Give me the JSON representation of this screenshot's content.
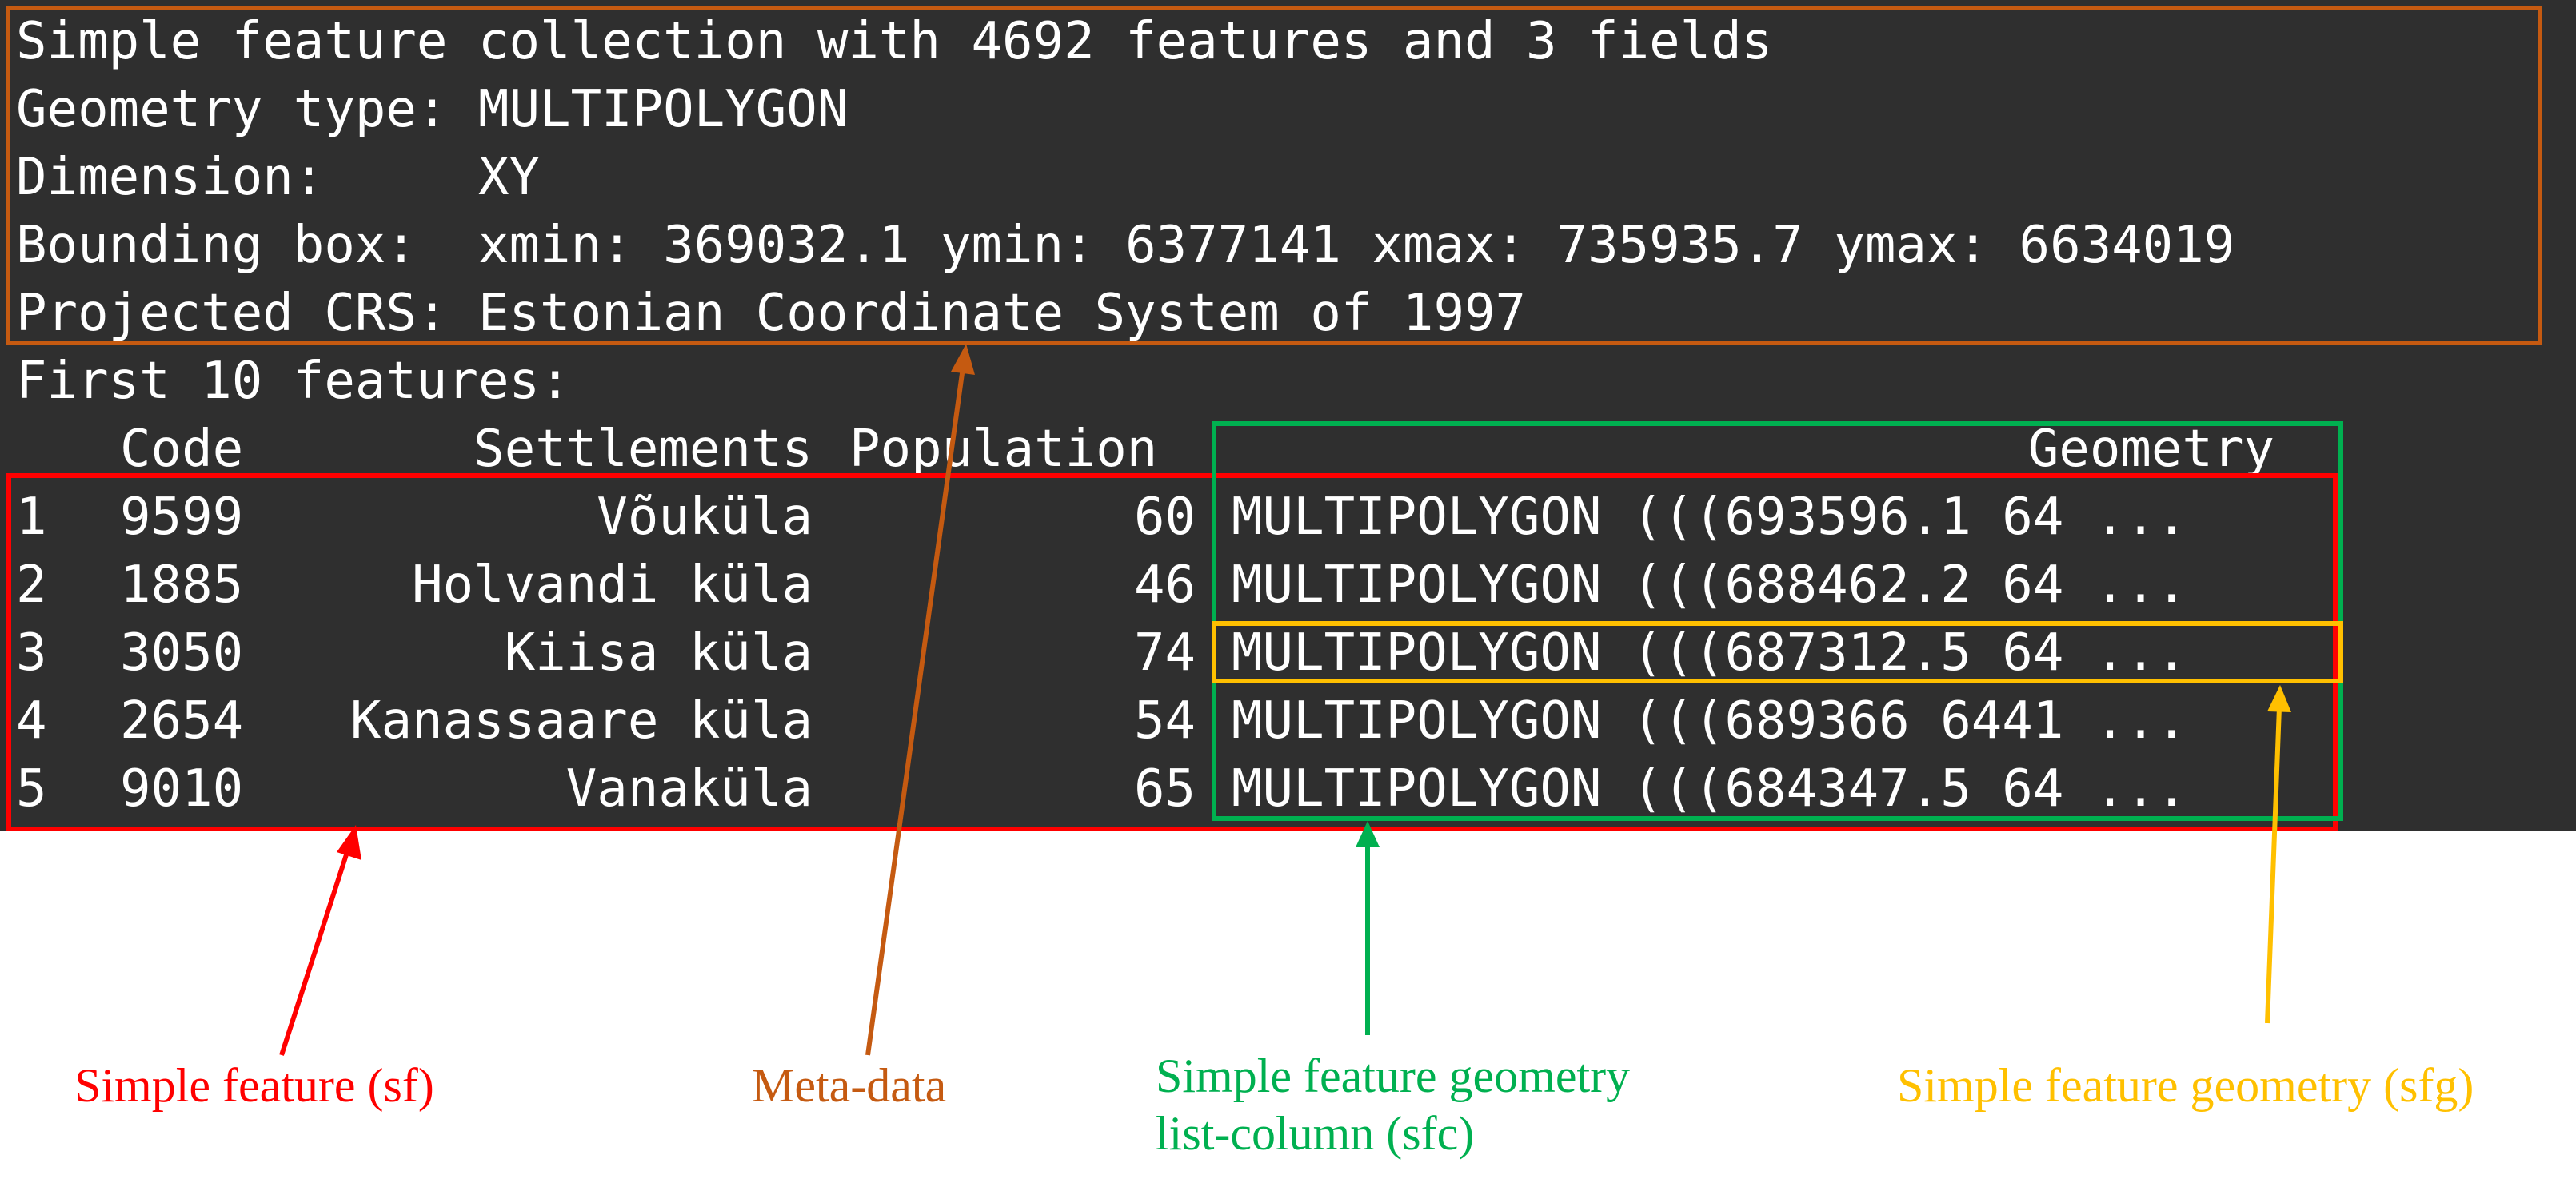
{
  "console": {
    "meta_lines": [
      "Simple feature collection with 4692 features and 3 fields",
      "Geometry type: MULTIPOLYGON",
      "Dimension:     XY",
      "Bounding box:  xmin: 369032.1 ymin: 6377141 xmax: 735935.7 ymax: 6634019",
      "Projected CRS: Estonian Coordinate System of 1997"
    ],
    "first_features_line": "First 10 features:",
    "columns": {
      "code": "Code",
      "settlements": "Settlements",
      "population": "Population",
      "geometry": "Geometry"
    },
    "rows": [
      {
        "index": "1",
        "code": "9599",
        "settlement": "Võuküla",
        "population": "60",
        "geometry": "MULTIPOLYGON (((693596.1 64 ..."
      },
      {
        "index": "2",
        "code": "1885",
        "settlement": "Holvandi küla",
        "population": "46",
        "geometry": "MULTIPOLYGON (((688462.2 64 ..."
      },
      {
        "index": "3",
        "code": "3050",
        "settlement": "Kiisa küla",
        "population": "74",
        "geometry": "MULTIPOLYGON (((687312.5 64 ..."
      },
      {
        "index": "4",
        "code": "2654",
        "settlement": "Kanassaare küla",
        "population": "54",
        "geometry": "MULTIPOLYGON (((689366 6441 ..."
      },
      {
        "index": "5",
        "code": "9010",
        "settlement": "Vanaküla",
        "population": "65",
        "geometry": "MULTIPOLYGON (((684347.5 64 ..."
      }
    ]
  },
  "labels": {
    "sf": "Simple feature (sf)",
    "meta": "Meta-data",
    "sfc_line1": "Simple feature geometry",
    "sfc_line2": "list-column (sfc)",
    "sfg": "Simple feature geometry (sfg)"
  },
  "colors": {
    "console_bg": "#2f2f2f",
    "sf": "#ff0000",
    "meta": "#c55a11",
    "sfc": "#00b050",
    "sfg": "#ffc000"
  }
}
